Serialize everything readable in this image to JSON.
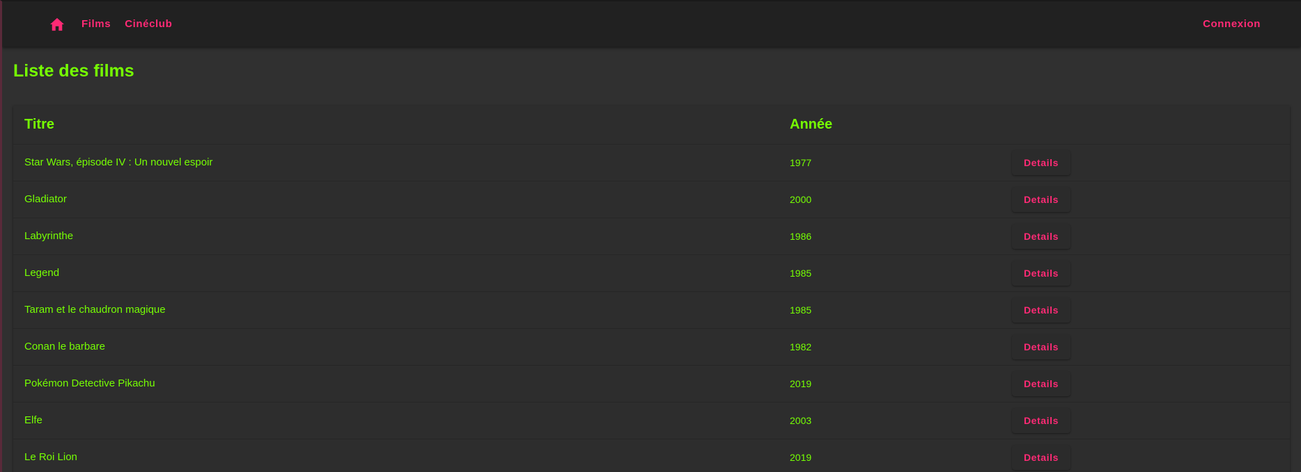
{
  "nav": {
    "home_icon": "home-icon",
    "links": [
      "Films",
      "Cinéclub"
    ],
    "login_label": "Connexion"
  },
  "page": {
    "title": "Liste des films"
  },
  "table": {
    "headers": {
      "title": "Titre",
      "year": "Année"
    },
    "details_label": "Details",
    "rows": [
      {
        "title": "Star Wars, épisode IV : Un nouvel espoir",
        "year": "1977"
      },
      {
        "title": "Gladiator",
        "year": "2000"
      },
      {
        "title": "Labyrinthe",
        "year": "1986"
      },
      {
        "title": "Legend",
        "year": "1985"
      },
      {
        "title": "Taram et le chaudron magique",
        "year": "1985"
      },
      {
        "title": "Conan le barbare",
        "year": "1982"
      },
      {
        "title": "Pokémon Detective Pikachu",
        "year": "2019"
      },
      {
        "title": "Elfe",
        "year": "2003"
      },
      {
        "title": "Le Roi Lion",
        "year": "2019"
      }
    ]
  },
  "colors": {
    "accent": "#ff2a75",
    "text_green": "#76ff03",
    "background": "#303030",
    "toolbar": "#212121"
  }
}
